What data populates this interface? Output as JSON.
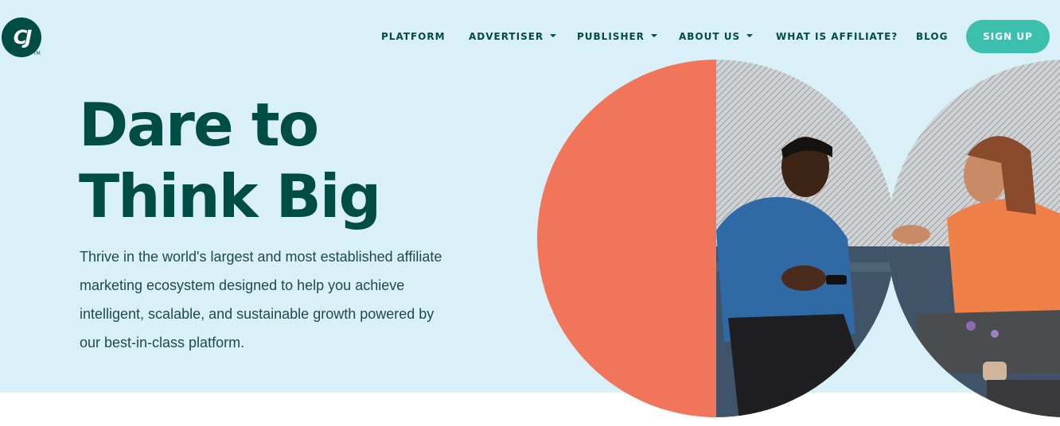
{
  "brand": {
    "logo_text": "CJ",
    "tm": "TM"
  },
  "nav": {
    "items": [
      {
        "label": "PLATFORM",
        "dropdown": false
      },
      {
        "label": "ADVERTISER",
        "dropdown": true
      },
      {
        "label": "PUBLISHER",
        "dropdown": true
      },
      {
        "label": "ABOUT US",
        "dropdown": true
      },
      {
        "label": "WHAT IS AFFILIATE?",
        "dropdown": false
      },
      {
        "label": "BLOG",
        "dropdown": false
      }
    ],
    "signup_label": "SIGN UP"
  },
  "hero": {
    "headline_line1": "Dare to",
    "headline_line2": "Think Big",
    "body": "Thrive in the world's largest and most established affiliate marketing ecosystem designed to help you achieve intelligent, scalable, and sustainable growth powered by our best-in-class platform.",
    "image_subject": "two people talking on a sofa"
  },
  "colors": {
    "hero_background": "#d9f0f8",
    "brand_dark": "#004d45",
    "accent_teal": "#3cbfae",
    "coral": "#f1755b"
  }
}
